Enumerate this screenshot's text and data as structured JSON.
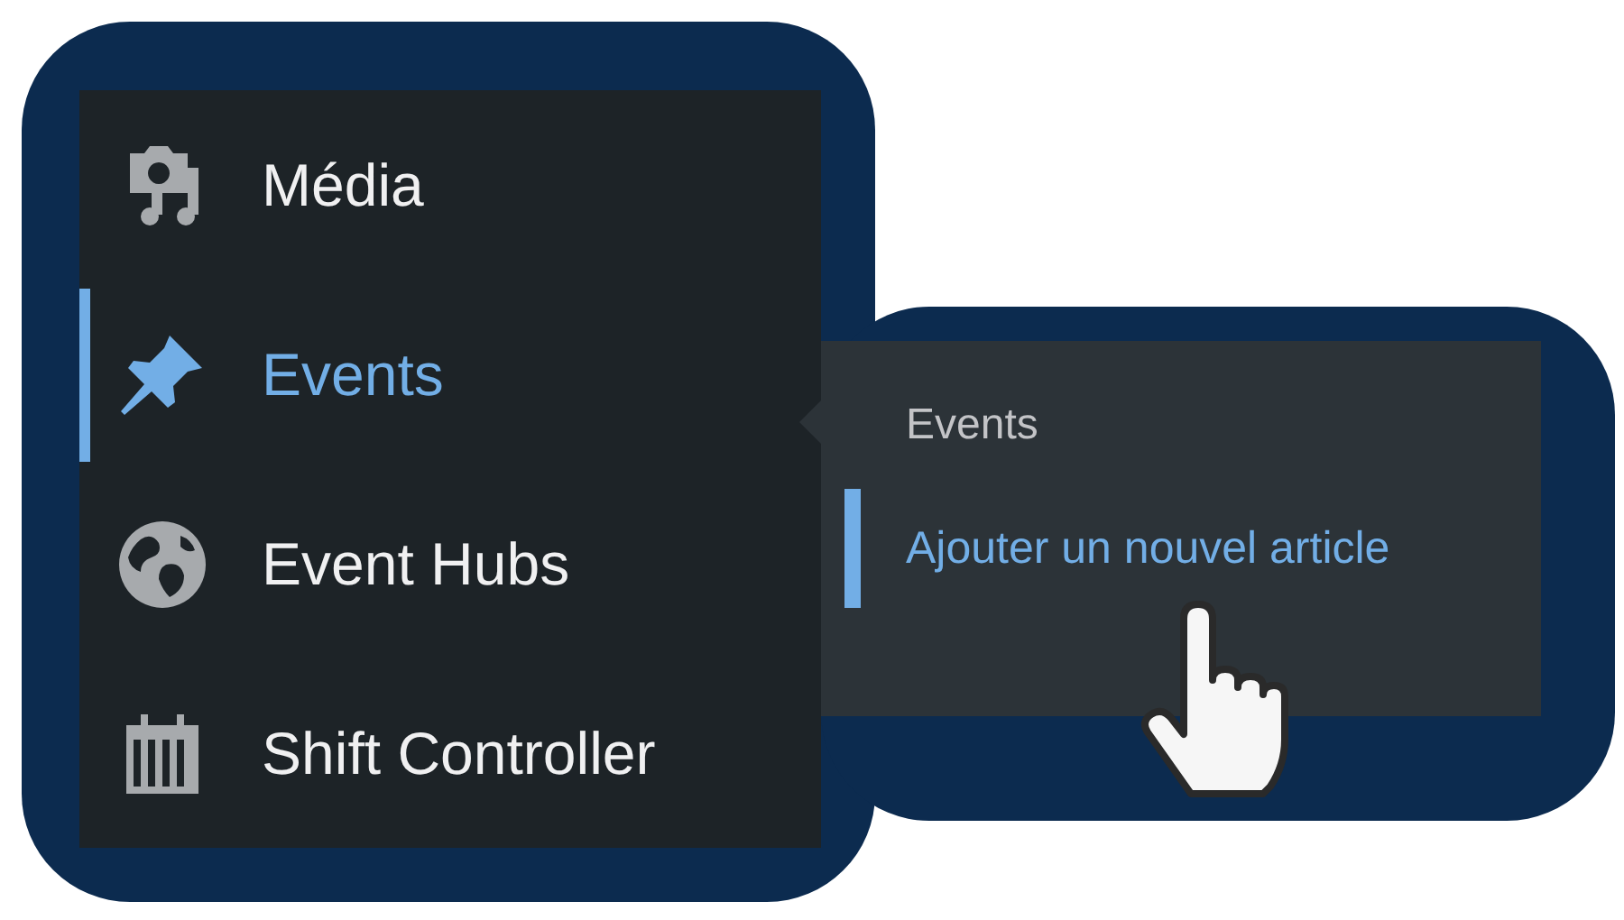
{
  "menu": {
    "items": [
      {
        "label": "Média",
        "selected": false
      },
      {
        "label": "Events",
        "selected": true
      },
      {
        "label": "Event Hubs",
        "selected": false
      },
      {
        "label": "Shift Controller",
        "selected": false
      }
    ]
  },
  "submenu": {
    "title": "Events",
    "items": [
      {
        "label": "Ajouter un nouvel article",
        "selected": true
      }
    ]
  }
}
